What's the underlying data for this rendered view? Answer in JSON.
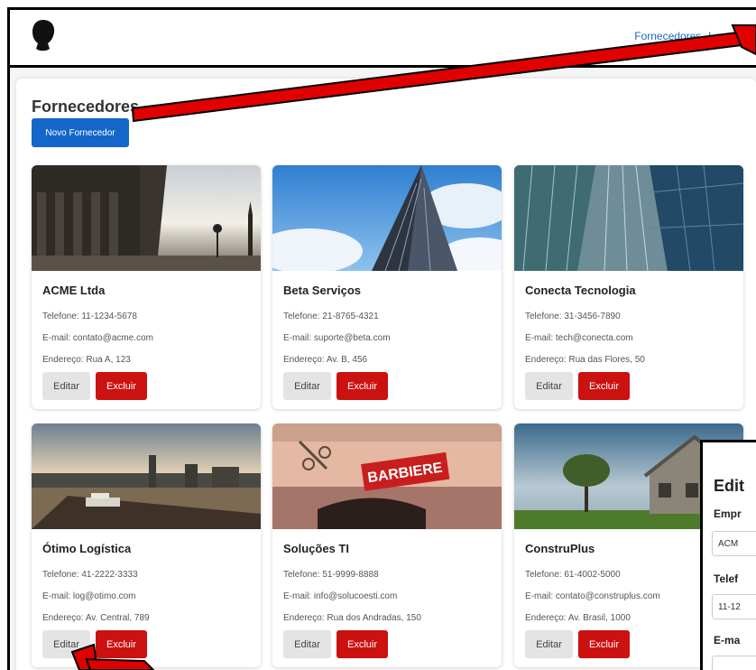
{
  "nav": {
    "links": [
      "Fornecedores",
      "Logout"
    ]
  },
  "page": {
    "title": "Fornecedores",
    "new_button": "Novo Fornecedor"
  },
  "labels": {
    "edit": "Editar",
    "delete": "Excluir"
  },
  "suppliers": [
    {
      "name": "ACME Ltda",
      "phone": "Telefone: 11-1234-5678",
      "email": "E-mail: contato@acme.com",
      "address": "Endereço: Rua A, 123"
    },
    {
      "name": "Beta Serviços",
      "phone": "Telefone: 21-8765-4321",
      "email": "E-mail: suporte@beta.com",
      "address": "Endereço: Av. B, 456"
    },
    {
      "name": "Conecta Tecnologia",
      "phone": "Telefone: 31-3456-7890",
      "email": "E-mail: tech@conecta.com",
      "address": "Endereço: Rua das Flores, 50"
    },
    {
      "name": "Ótimo Logística",
      "phone": "Telefone: 41-2222-3333",
      "email": "E-mail: log@otimo.com",
      "address": "Endereço: Av. Central, 789"
    },
    {
      "name": "Soluções TI",
      "phone": "Telefone: 51-9999-8888",
      "email": "E-mail: info@solucoesti.com",
      "address": "Endereço: Rua dos Andradas, 150"
    },
    {
      "name": "ConstruPlus",
      "phone": "Telefone: 61-4002-5000",
      "email": "E-mail: contato@construplus.com",
      "address": "Endereço: Av. Brasil, 1000"
    }
  ],
  "edit_panel": {
    "title": "Edit",
    "empresa_label": "Empr",
    "empresa_value": "ACM",
    "telefone_label": "Telef",
    "telefone_value": "11-12",
    "email_label": "E-ma"
  },
  "photo_sign": "BARBIERE",
  "colors": {
    "primary": "#1466c8",
    "danger": "#cc1111",
    "link": "#1d66c4",
    "annotation_arrow": "#e00000"
  }
}
